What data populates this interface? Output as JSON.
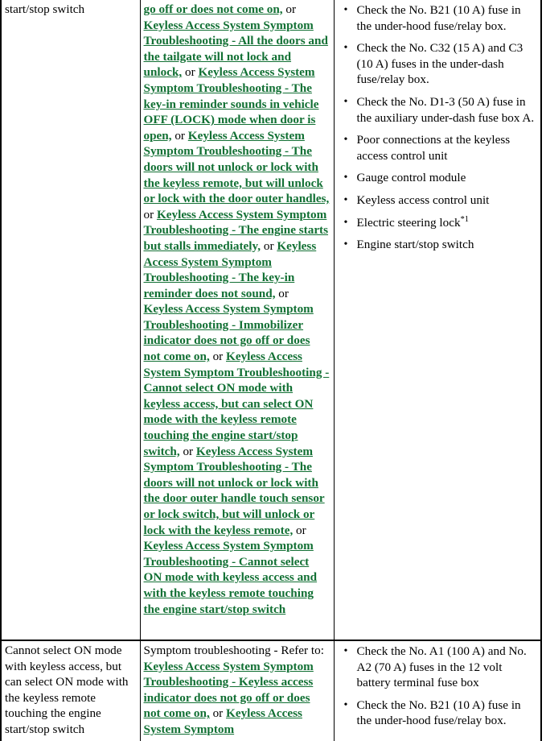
{
  "document": {
    "type": "troubleshooting-table",
    "link_color": "#127034",
    "text_color": "#000000",
    "border_color": "#000000"
  },
  "rows": [
    {
      "symptom": "start/stop switch",
      "diagnosis_intro": "",
      "diagnosis_runs": [
        {
          "text": "go off or does not come on,",
          "link": true
        },
        {
          "text": " or ",
          "link": false
        },
        {
          "text": "Keyless Access System Symptom Troubleshooting - All the doors and the tailgate will not lock and unlock,",
          "link": true
        },
        {
          "text": " or ",
          "link": false
        },
        {
          "text": "Keyless Access System Symptom Troubleshooting - The key-in reminder sounds in vehicle OFF (LOCK) mode when door is open,",
          "link": true
        },
        {
          "text": " or ",
          "link": false
        },
        {
          "text": "Keyless Access System Symptom Troubleshooting - The doors will not unlock or lock with the keyless remote, but will unlock or lock with the door outer handles,",
          "link": true
        },
        {
          "text": " or ",
          "link": false
        },
        {
          "text": "Keyless Access System Symptom Troubleshooting - The engine starts but stalls immediately,",
          "link": true
        },
        {
          "text": " or ",
          "link": false
        },
        {
          "text": "Keyless Access System Symptom Troubleshooting - The key-in reminder does not sound,",
          "link": true
        },
        {
          "text": " or ",
          "link": false
        },
        {
          "text": "Keyless Access System Symptom Troubleshooting - Immobilizer indicator does not go off or does not come on,",
          "link": true
        },
        {
          "text": " or ",
          "link": false
        },
        {
          "text": "Keyless Access System Symptom Troubleshooting - Cannot select ON mode with keyless access, but can select ON mode with the keyless remote touching the engine start/stop switch,",
          "link": true
        },
        {
          "text": " or ",
          "link": false
        },
        {
          "text": "Keyless Access System Symptom Troubleshooting - The doors will not unlock or lock with the door outer handle touch sensor or lock switch, but will unlock or lock with the keyless remote,",
          "link": true
        },
        {
          "text": " or ",
          "link": false
        },
        {
          "text": "Keyless Access System Symptom Troubleshooting - Cannot select ON mode with keyless access and with the keyless remote touching the engine start/stop switch",
          "link": true
        }
      ],
      "checks": [
        "Check the No. B21 (10 A) fuse in the under-hood fuse/relay box.",
        "Check the No. C32 (15 A) and C3 (10 A) fuses in the under-dash fuse/relay box.",
        "Check the No. D1-3 (50 A) fuse in the auxiliary under-dash fuse box A.",
        "Poor connections at the keyless access control unit",
        "Gauge control module",
        "Keyless access control unit",
        "Electric steering lock",
        "Engine start/stop switch"
      ],
      "check_footnotes": {
        "6": "*1"
      }
    },
    {
      "symptom": "Cannot select ON mode with keyless access, but can select ON mode with the keyless remote touching the engine start/stop switch",
      "diagnosis_runs": [
        {
          "text": "Symptom troubleshooting - Refer to: ",
          "link": false
        },
        {
          "text": "Keyless Access System Symptom Troubleshooting - Keyless access indicator does not go off or does not come on,",
          "link": true
        },
        {
          "text": " or ",
          "link": false
        },
        {
          "text": "Keyless Access System Symptom",
          "link": true
        }
      ],
      "checks": [
        "Check the No. A1 (100 A) and No. A2 (70 A) fuses in the 12 volt battery terminal fuse box",
        "Check the No. B21 (10 A) fuse in the under-hood fuse/relay box."
      ]
    }
  ]
}
